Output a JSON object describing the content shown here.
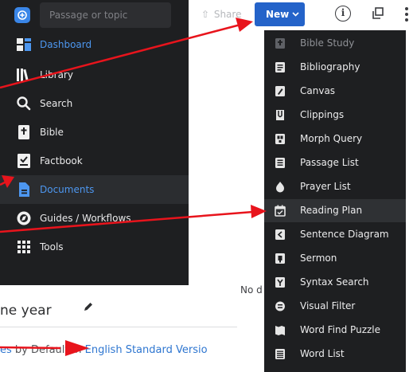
{
  "sidebar": {
    "search_placeholder": "Passage or topic",
    "items": [
      {
        "label": "Dashboard",
        "icon": "dashboard-icon",
        "color": "blue"
      },
      {
        "label": "Library",
        "icon": "library-icon"
      },
      {
        "label": "Search",
        "icon": "search-icon"
      },
      {
        "label": "Bible",
        "icon": "bible-icon"
      },
      {
        "label": "Factbook",
        "icon": "factbook-icon"
      },
      {
        "label": "Documents",
        "icon": "documents-icon",
        "color": "blue",
        "active": true
      },
      {
        "label": "Guides / Workflows",
        "icon": "guides-icon"
      },
      {
        "label": "Tools",
        "icon": "tools-icon"
      }
    ]
  },
  "toolbar": {
    "share_label": "Share",
    "new_label": "New"
  },
  "menu": {
    "items": [
      {
        "label": "Bible Study",
        "icon": "bible-study-icon"
      },
      {
        "label": "Bibliography",
        "icon": "bibliography-icon"
      },
      {
        "label": "Canvas",
        "icon": "canvas-icon"
      },
      {
        "label": "Clippings",
        "icon": "clippings-icon"
      },
      {
        "label": "Morph Query",
        "icon": "morph-query-icon"
      },
      {
        "label": "Passage List",
        "icon": "passage-list-icon"
      },
      {
        "label": "Prayer List",
        "icon": "prayer-list-icon"
      },
      {
        "label": "Reading Plan",
        "icon": "reading-plan-icon",
        "highlighted": true
      },
      {
        "label": "Sentence Diagram",
        "icon": "sentence-diagram-icon"
      },
      {
        "label": "Sermon",
        "icon": "sermon-icon"
      },
      {
        "label": "Syntax Search",
        "icon": "syntax-search-icon"
      },
      {
        "label": "Visual Filter",
        "icon": "visual-filter-icon"
      },
      {
        "label": "Word Find Puzzle",
        "icon": "word-find-puzzle-icon"
      },
      {
        "label": "Word List",
        "icon": "word-list-icon"
      }
    ]
  },
  "main": {
    "no_docs_text": "No d",
    "plan_title": "ne year",
    "bottom": {
      "part1": "es",
      "part2": " by ",
      "part3": "Default",
      "part4": " in ",
      "part5": "English Standard Versio"
    }
  },
  "colors": {
    "sidebar_bg": "#1e1f21",
    "accent_blue": "#2463c9",
    "link_blue": "#2e76d0",
    "arrow_red": "#e8141c"
  }
}
